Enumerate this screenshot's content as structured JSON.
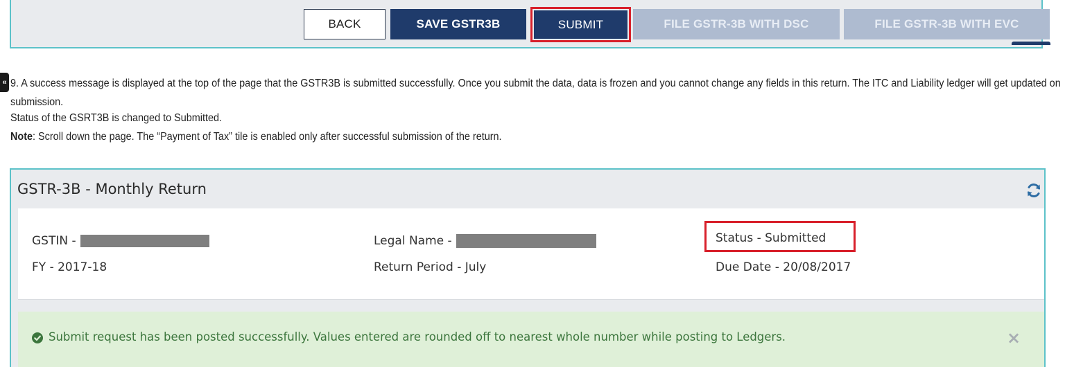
{
  "toolbar": {
    "back_label": "BACK",
    "save_label": "SAVE GSTR3B",
    "submit_label": "SUBMIT",
    "file_dsc_label": "FILE GSTR-3B WITH DSC",
    "file_evc_label": "FILE GSTR-3B WITH EVC"
  },
  "collapse_tab": {
    "glyph": "«"
  },
  "instructions": {
    "step_text": "9. A success message is displayed at the top of the page that the GSTR3B is submitted successfully. Once you submit the data, data is frozen and you cannot change any fields in this return. The ITC and Liability ledger will get updated on submission.",
    "status_text": "Status of the GSRT3B is changed to Submitted.",
    "note_label": "Note",
    "note_text": ": Scroll down the page. The “Payment of Tax” tile is enabled only after successful submission of the return."
  },
  "return_card": {
    "title": "GSTR-3B - Monthly Return",
    "gstin_label": "GSTIN -",
    "legal_name_label": "Legal Name -",
    "status_text": "Status - Submitted",
    "fy_text": "FY - 2017-18",
    "return_period_text": "Return Period - July",
    "due_date_text": "Due Date - 20/08/2017"
  },
  "alert": {
    "message": "Submit request has been posted successfully. Values entered are rounded off to nearest whole number while posting to Ledgers.",
    "close_glyph": "×"
  },
  "colors": {
    "primary_button": "#1f3b6b",
    "disabled_button": "#aebbd0",
    "panel_border": "#5cc2c9",
    "highlight_red": "#d8202b",
    "success_bg": "#dff0d8",
    "success_text": "#3c763d"
  },
  "icons": {
    "refresh": "refresh-icon",
    "success": "check-circle-icon",
    "close": "close-icon",
    "collapse": "double-chevron-left-icon"
  }
}
